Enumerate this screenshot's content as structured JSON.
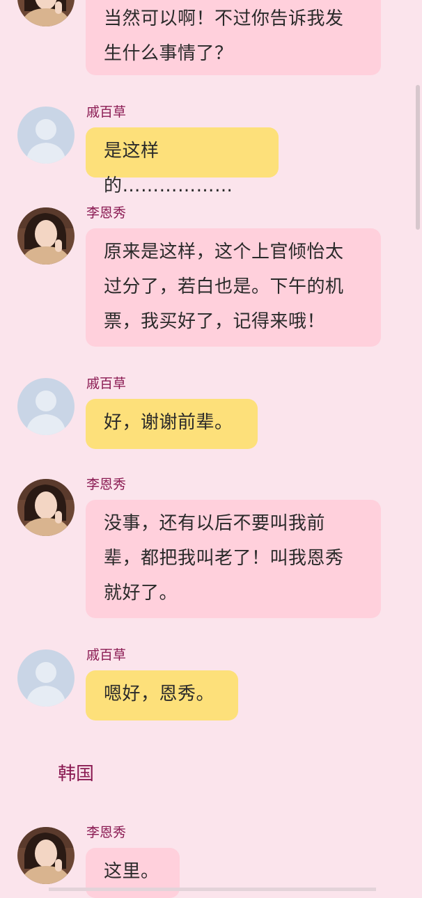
{
  "messages": [
    {
      "sender": "李恩秀",
      "text": "当然可以啊！不过你告诉我发\n生什么事情了？",
      "style": "pink"
    },
    {
      "sender": "戚百草",
      "text": "是这样的………………",
      "style": "yellow"
    },
    {
      "sender": "李恩秀",
      "text": "原来是这样，这个上官倾怡太\n过分了，若白也是。下午的机\n票，我买好了，记得来哦！",
      "style": "pink"
    },
    {
      "sender": "戚百草",
      "text": "好，谢谢前辈。",
      "style": "yellow"
    },
    {
      "sender": "李恩秀",
      "text": "没事，还有以后不要叫我前\n辈，都把我叫老了！叫我恩秀\n就好了。",
      "style": "pink"
    },
    {
      "sender": "戚百草",
      "text": "嗯好，恩秀。",
      "style": "yellow"
    },
    {
      "sender": "李恩秀",
      "text": "这里。",
      "style": "pink"
    }
  ],
  "narration": "韩国",
  "colors": {
    "background": "#fbe4ec",
    "pink_bubble": "#ffd0dc",
    "yellow_bubble": "#fde07a",
    "name_text": "#8a1a52"
  },
  "icons": {
    "female_avatar": "woman-portrait-avatar",
    "default_avatar": "default-person-avatar"
  }
}
